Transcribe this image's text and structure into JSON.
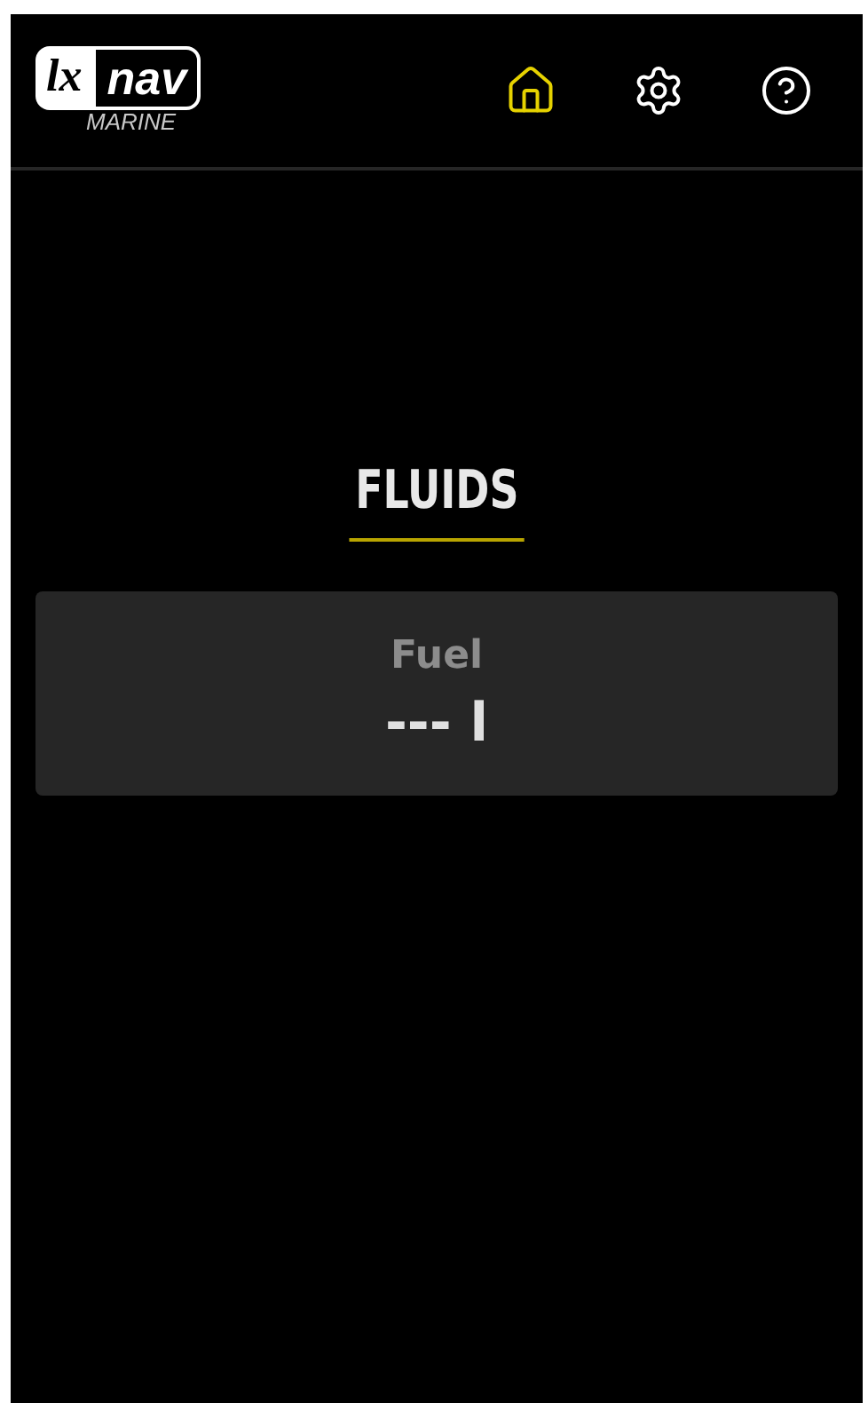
{
  "logo": {
    "mark": "lx",
    "name": "nav",
    "subtitle": "MARINE"
  },
  "nav": [
    {
      "kind": "home",
      "selected": true
    },
    {
      "kind": "settings",
      "selected": false
    },
    {
      "kind": "help",
      "selected": false
    }
  ],
  "title": "FLUIDS",
  "tanks": [
    {
      "name": "Fuel",
      "value": "--- l"
    }
  ]
}
